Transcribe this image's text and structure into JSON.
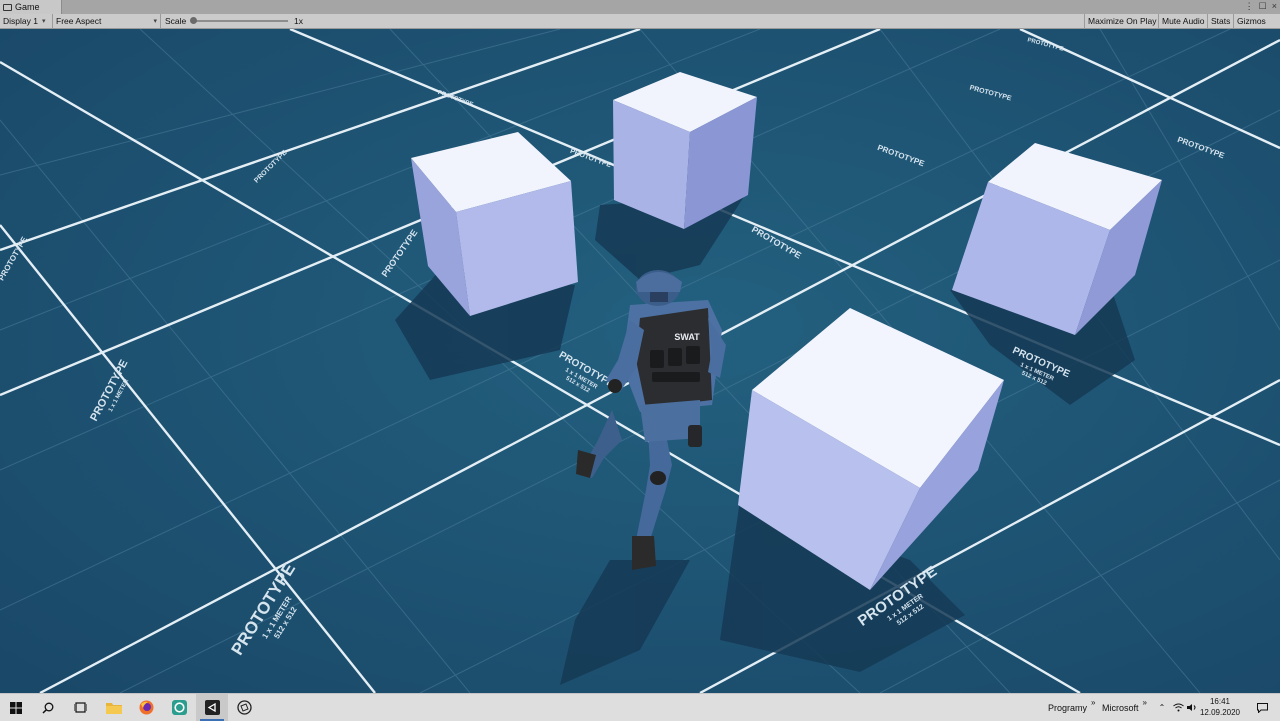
{
  "window": {
    "tab_title": "Game",
    "tab_icon": "game-view-icon"
  },
  "toolbar": {
    "display_label": "Display 1",
    "aspect_label": "Free Aspect",
    "scale_label": "Scale",
    "scale_value": "1x",
    "maximize_label": "Maximize On Play",
    "mute_label": "Mute Audio",
    "stats_label": "Stats",
    "gizmos_label": "Gizmos"
  },
  "scene": {
    "floor_texture_label": "PROTOTYPE",
    "floor_texture_sub1": "1 x 1 METER",
    "floor_texture_sub2": "512 x 512",
    "character_vest_text": "SWAT",
    "colors": {
      "floor": "#1f5677",
      "grid_major": "#e8f1f7",
      "grid_minor": "#4d7d9c",
      "cube_top": "#f1f3fd",
      "cube_left": "#a6b0e3",
      "cube_right": "#8a95d4",
      "shadow": "#163a57"
    }
  },
  "taskbar": {
    "apps": [
      {
        "icon": "windows-start-icon"
      },
      {
        "icon": "search-icon"
      },
      {
        "icon": "task-view-icon"
      },
      {
        "icon": "file-explorer-icon"
      },
      {
        "icon": "firefox-icon"
      },
      {
        "icon": "unity-hub-icon"
      },
      {
        "icon": "unity-editor-icon"
      },
      {
        "icon": "unity-app-icon"
      }
    ],
    "toolbar1_label": "Programy",
    "toolbar2_label": "Microsoft",
    "time": "16:41",
    "date": "12.09.2020"
  }
}
